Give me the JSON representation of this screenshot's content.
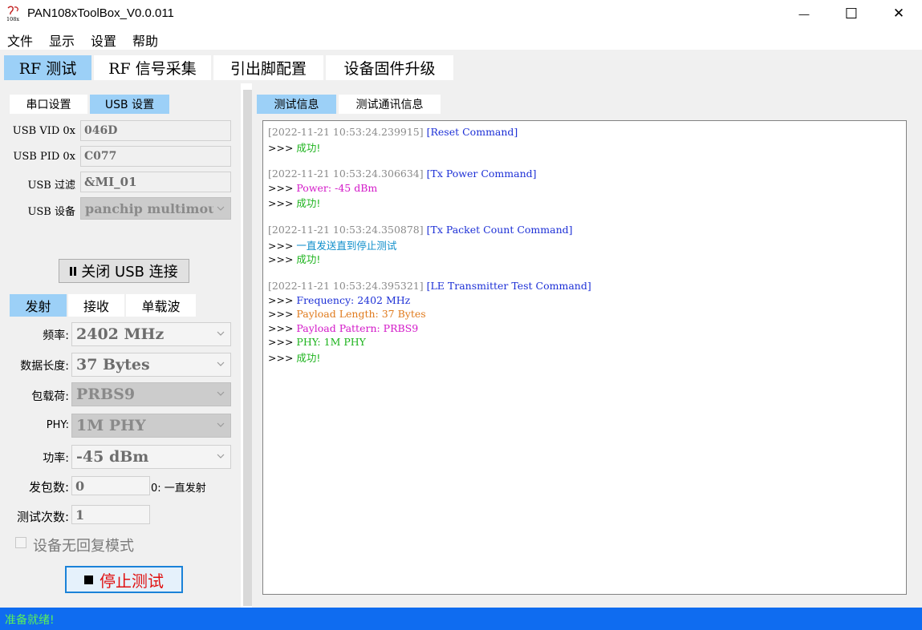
{
  "window": {
    "title": "PAN108xToolBox_V0.0.011",
    "logo_text": "108x",
    "minimize": "—",
    "maximize": "☐",
    "close": "✕"
  },
  "menu": [
    "文件",
    "显示",
    "设置",
    "帮助"
  ],
  "main_tabs": [
    "RF 测试",
    "RF 信号采集",
    "引出脚配置",
    "设备固件升级"
  ],
  "main_tab_active": "RF 测试",
  "connection_tabs": [
    "串口设置",
    "USB 设置"
  ],
  "connection_tab_active": "USB 设置",
  "usb": {
    "vid_label": "USB VID 0x",
    "vid_value": "046D",
    "pid_label": "USB PID 0x",
    "pid_value": "C077",
    "filter_label": "USB 过滤",
    "filter_value": "&MI_01",
    "device_label": "USB 设备",
    "device_value": "panchip multimouse"
  },
  "close_usb_button": "关闭 USB 连接",
  "mode_tabs": [
    "发射",
    "接收",
    "单载波"
  ],
  "mode_tab_active": "发射",
  "tx": {
    "freq_label": "频率:",
    "freq_value": "2402 MHz",
    "length_label": "数据长度:",
    "length_value": "37 Bytes",
    "payload_label": "包载荷:",
    "payload_value": "PRBS9",
    "phy_label": "PHY:",
    "phy_value": "1M PHY",
    "power_label": "功率:",
    "power_value": "-45 dBm",
    "count_label": "发包数:",
    "count_value": "0",
    "count_hint": "0: 一直发射",
    "times_label": "测试次数:",
    "times_value": "1",
    "no_reply_label": "设备无回复模式"
  },
  "stop_button": "停止测试",
  "log_tabs": [
    "测试信息",
    "测试通讯信息"
  ],
  "log_tab_active": "测试信息",
  "log": {
    "b1_ts": "[2022-11-21 10:53:24.239915]",
    "b1_cmd": "[Reset Command]",
    "b1_ok": "成功!",
    "b2_ts": "[2022-11-21 10:53:24.306634]",
    "b2_cmd": "[Tx Power Command]",
    "b2_power": "Power: -45 dBm",
    "b2_ok": "成功!",
    "b3_ts": "[2022-11-21 10:53:24.350878]",
    "b3_cmd": "[Tx Packet Count Command]",
    "b3_info": "一直发送直到停止测试",
    "b3_ok": "成功!",
    "b4_ts": "[2022-11-21 10:53:24.395321]",
    "b4_cmd": "[LE Transmitter Test Command]",
    "b4_freq": "Frequency: 2402 MHz",
    "b4_len": "Payload Length: 37 Bytes",
    "b4_pattern": "Payload Pattern: PRBS9",
    "b4_phy": "PHY: 1M PHY",
    "b4_ok": "成功!",
    "prompt": ">>> "
  },
  "status": "准备就绪!",
  "colors": {
    "tab_active": "#9cd0f7",
    "status_bar": "#0f6cf0",
    "status_text": "#5af05a",
    "log_timestamp": "#8a8a8a",
    "log_command": "#1c2fd6",
    "log_success": "#1db31d",
    "stop_text": "#e01010"
  }
}
